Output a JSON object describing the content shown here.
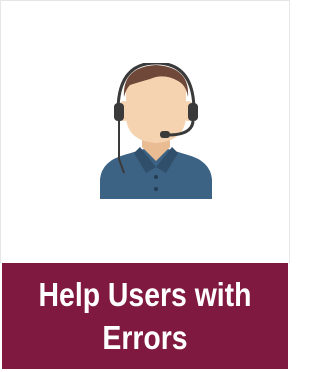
{
  "tile": {
    "title": "Help Users with\nErrors",
    "icon": "support-agent-headset-icon",
    "colors": {
      "banner": "#80193f",
      "background": "#ffffff",
      "shirt": "#3d6384",
      "skin": "#f6d3b0",
      "hair": "#6f4839",
      "headset": "#3a3a3a"
    }
  }
}
